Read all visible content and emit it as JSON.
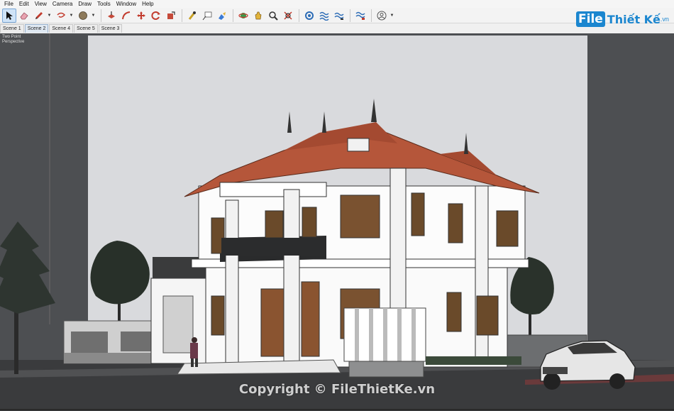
{
  "menu": [
    "File",
    "Edit",
    "View",
    "Camera",
    "Draw",
    "Tools",
    "Window",
    "Help"
  ],
  "toolbar": {
    "tools": [
      {
        "name": "select-icon",
        "active": true
      },
      {
        "name": "eraser-icon"
      },
      {
        "name": "pencil-icon",
        "dropdown": true
      },
      {
        "name": "lasso-icon",
        "dropdown": true
      },
      {
        "name": "paint-bucket-icon",
        "dropdown": true
      },
      {
        "name": "push-pull-icon"
      },
      {
        "name": "follow-me-icon"
      },
      {
        "name": "move-icon"
      },
      {
        "name": "rotate-icon"
      },
      {
        "name": "scale-icon"
      },
      {
        "name": "tape-measure-icon"
      },
      {
        "name": "text-icon"
      },
      {
        "name": "paint-icon"
      },
      {
        "name": "orbit-icon"
      },
      {
        "name": "pan-icon"
      },
      {
        "name": "zoom-icon"
      },
      {
        "name": "zoom-extents-icon"
      },
      {
        "name": "warehouse-icon"
      },
      {
        "name": "extension-icon"
      },
      {
        "name": "layers-icon"
      },
      {
        "name": "styles-icon"
      },
      {
        "name": "account-icon",
        "dropdown": true
      }
    ]
  },
  "scenes": [
    {
      "label": "Scene 1",
      "active": false
    },
    {
      "label": "Scene 2",
      "active": true
    },
    {
      "label": "Scene 4",
      "active": false
    },
    {
      "label": "Scene 5",
      "active": false
    },
    {
      "label": "Scene 3",
      "active": false
    }
  ],
  "viewport": {
    "label_line1": "Two Point",
    "label_line2": "Perspective"
  },
  "logo": {
    "file": "File",
    "rest": "Thiết Kế",
    "vn": ".vn"
  },
  "watermark": "Copyright © FileThietKe.vn",
  "colors": {
    "roof": "#b5563a",
    "wall": "#ffffff",
    "sky": "#d8d9dc",
    "ground": "#3c3d3f",
    "accent": "#1b86cf"
  }
}
